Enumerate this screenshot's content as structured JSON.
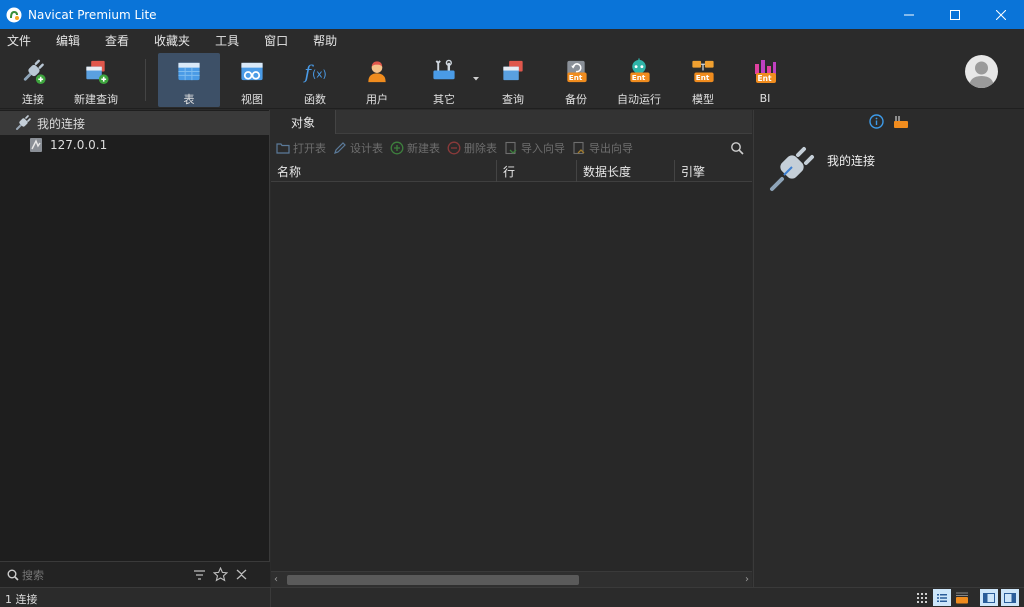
{
  "window": {
    "title": "Navicat Premium Lite"
  },
  "menu": [
    "文件",
    "编辑",
    "查看",
    "收藏夹",
    "工具",
    "窗口",
    "帮助"
  ],
  "toolbar": {
    "connect": "连接",
    "new_query": "新建查询",
    "table": "表",
    "view": "视图",
    "function": "函数",
    "user": "用户",
    "other": "其它",
    "query": "查询",
    "backup": "备份",
    "automation": "自动运行",
    "model": "模型",
    "bi": "BI",
    "ent_badge": "Ent"
  },
  "navigator": {
    "group": "我的连接",
    "connection": "127.0.0.1",
    "search_placeholder": "搜索"
  },
  "objects": {
    "tab": "对象",
    "actions": {
      "open_table": "打开表",
      "design_table": "设计表",
      "new_table": "新建表",
      "delete_table": "删除表",
      "import_wizard": "导入向导",
      "export_wizard": "导出向导"
    },
    "columns": [
      "名称",
      "行",
      "数据长度",
      "引擎"
    ]
  },
  "info": {
    "title": "我的连接"
  },
  "status": {
    "text": "1 连接"
  },
  "colors": {
    "titlebar": "#0a74d8",
    "accent_green": "#4caf50",
    "ent_orange": "#f08c1e"
  }
}
